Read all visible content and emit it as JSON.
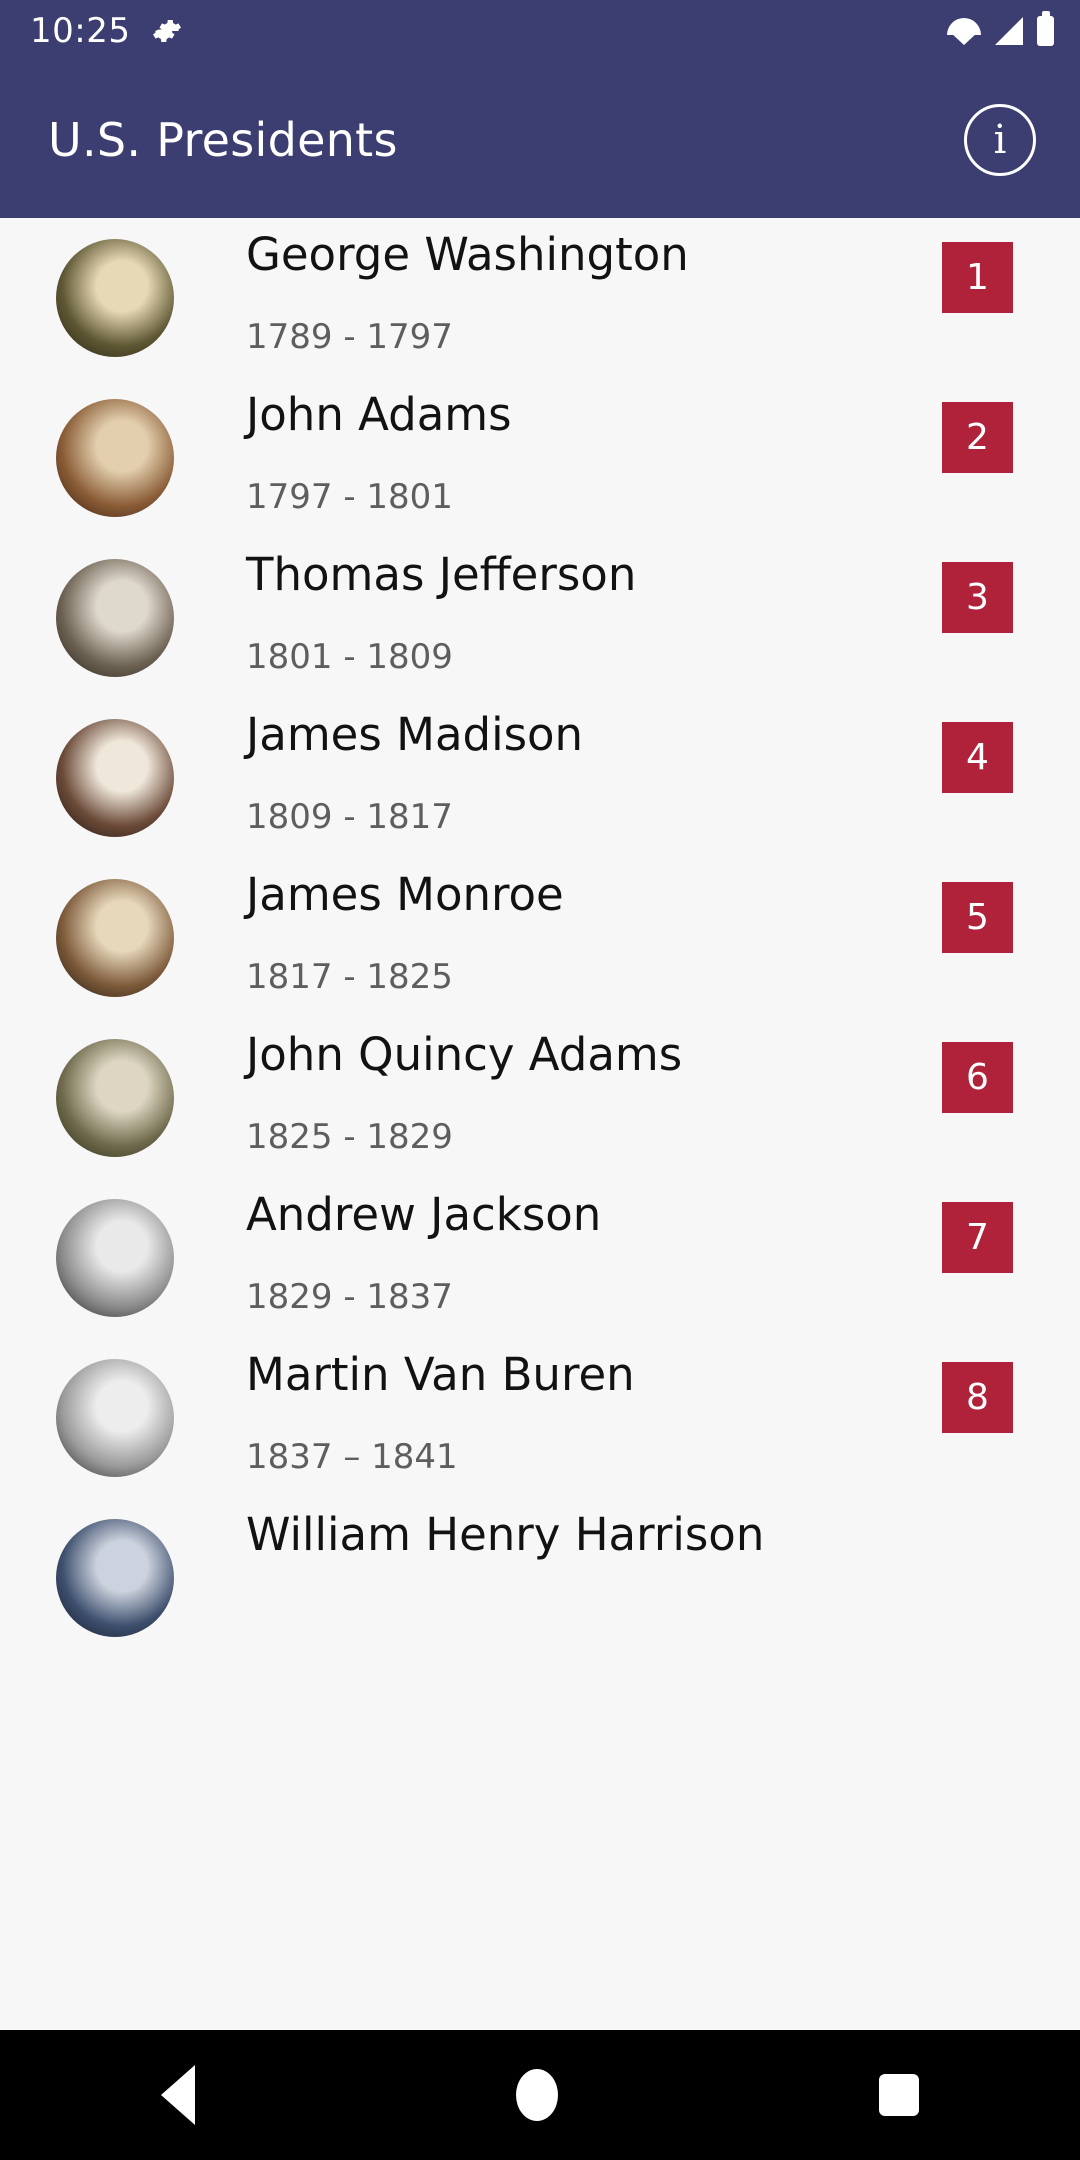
{
  "status_bar": {
    "clock": "10:25",
    "icons": [
      "gear-icon",
      "wifi-icon",
      "signal-icon",
      "battery-icon"
    ]
  },
  "app_bar": {
    "title": "U.S. Presidents",
    "info_label": "i",
    "background_color": "#3C3D70"
  },
  "theme": {
    "badge_color": "#B0223A",
    "list_background": "#F7F7F8",
    "name_color": "#121212",
    "years_color": "#5E5E5E"
  },
  "list": {
    "rows": [
      {
        "name": "George Washington",
        "years": "1789 - 1797",
        "number": "1",
        "portrait": "portrait-george-washington",
        "c1": "#e8d9b6",
        "c2": "#5e5733",
        "c3": "#1d1a10"
      },
      {
        "name": "John Adams",
        "years": "1797 - 1801",
        "number": "2",
        "portrait": "portrait-john-adams",
        "c1": "#e3cfae",
        "c2": "#8a5c36",
        "c3": "#2a160c"
      },
      {
        "name": "Thomas Jefferson",
        "years": "1801 - 1809",
        "number": "3",
        "portrait": "portrait-thomas-jefferson",
        "c1": "#dfd8cc",
        "c2": "#6d6253",
        "c3": "#1c1913"
      },
      {
        "name": "James Madison",
        "years": "1809 - 1817",
        "number": "4",
        "portrait": "portrait-james-madison",
        "c1": "#efe7da",
        "c2": "#6b4a38",
        "c3": "#120d0a"
      },
      {
        "name": "James Monroe",
        "years": "1817 - 1825",
        "number": "5",
        "portrait": "portrait-james-monroe",
        "c1": "#e7d7bb",
        "c2": "#7d5a3a",
        "c3": "#14100b"
      },
      {
        "name": "John Quincy Adams",
        "years": "1825 - 1829",
        "number": "6",
        "portrait": "portrait-john-quincy-adams",
        "c1": "#ded6c2",
        "c2": "#6f6a4c",
        "c3": "#20200f"
      },
      {
        "name": "Andrew Jackson",
        "years": "1829 - 1837",
        "number": "7",
        "portrait": "portrait-andrew-jackson",
        "c1": "#e9e9e9",
        "c2": "#8d8d8d",
        "c3": "#141414"
      },
      {
        "name": "Martin Van Buren",
        "years": "1837 – 1841",
        "number": "8",
        "portrait": "portrait-martin-van-buren",
        "c1": "#ededed",
        "c2": "#9a9a9a",
        "c3": "#1a1a1a"
      },
      {
        "name": "William Henry Harrison",
        "years": "",
        "number": "",
        "portrait": "portrait-william-henry-harrison",
        "c1": "#cdd3de",
        "c2": "#3d4f6d",
        "c3": "#0e1320"
      }
    ]
  },
  "nav_bar": {
    "items": [
      "back-button",
      "home-button",
      "recents-button"
    ]
  }
}
